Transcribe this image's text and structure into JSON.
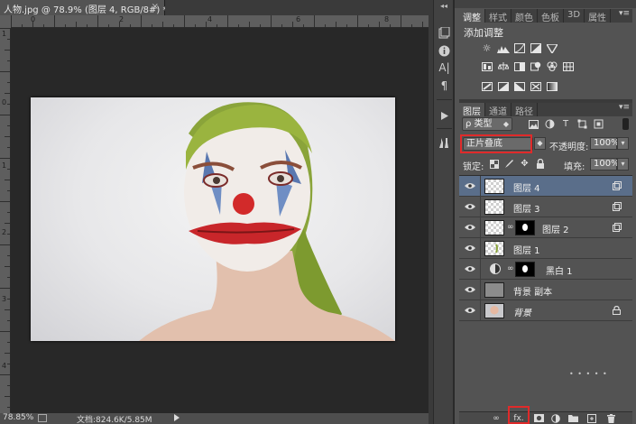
{
  "document": {
    "tab_title": "人物.jpg @ 78.9% (图层 4, RGB/8#) *",
    "close_glyph": "×"
  },
  "ruler": {
    "top_numbers": [
      "0",
      "2",
      "4",
      "6",
      "8"
    ],
    "left_numbers": [
      "1",
      "0",
      "1",
      "2",
      "3",
      "4",
      "5",
      "6"
    ]
  },
  "status": {
    "zoom": "78.85%",
    "doc_info": "文档:824.6K/5.85M"
  },
  "tools": {
    "items": [
      "history-icon",
      "info-icon",
      "character-icon",
      "paragraph-icon",
      "actions-icon",
      "tool-presets-icon"
    ]
  },
  "adjust_panel": {
    "tabs": [
      "调整",
      "样式",
      "颜色",
      "色板",
      "3D",
      "属性"
    ],
    "active_tab": "调整",
    "title": "添加调整",
    "menu_glyph": "▾≡"
  },
  "layers_panel": {
    "tabs": [
      "图层",
      "通道",
      "路径"
    ],
    "active_tab": "图层",
    "filter_kind": "ρ 类型",
    "blend_mode": "正片叠底",
    "opacity_label": "不透明度:",
    "opacity_value": "100%",
    "lock_label": "锁定:",
    "fill_label": "填充:",
    "fill_value": "100%",
    "layers": [
      {
        "name": "图层 4",
        "selected": true,
        "type": "pixel"
      },
      {
        "name": "图层 3",
        "selected": false,
        "type": "pixel"
      },
      {
        "name": "图层 2",
        "selected": false,
        "type": "masked"
      },
      {
        "name": "图层 1",
        "selected": false,
        "type": "pixel"
      },
      {
        "name": "黑白 1",
        "selected": false,
        "type": "adjustment"
      },
      {
        "name": "背景 副本",
        "selected": false,
        "type": "gray"
      },
      {
        "name": "背景",
        "selected": false,
        "type": "background"
      }
    ],
    "bottom_icons": [
      "link-icon",
      "fx-icon",
      "mask-icon",
      "adjustment-icon",
      "group-icon",
      "new-layer-icon",
      "delete-icon"
    ],
    "fx_label": "fx.",
    "dots": "• • • • •"
  },
  "colors": {
    "highlight": "#e02a2a",
    "selected_layer": "#5a6e8a",
    "panel_bg": "#535353"
  }
}
